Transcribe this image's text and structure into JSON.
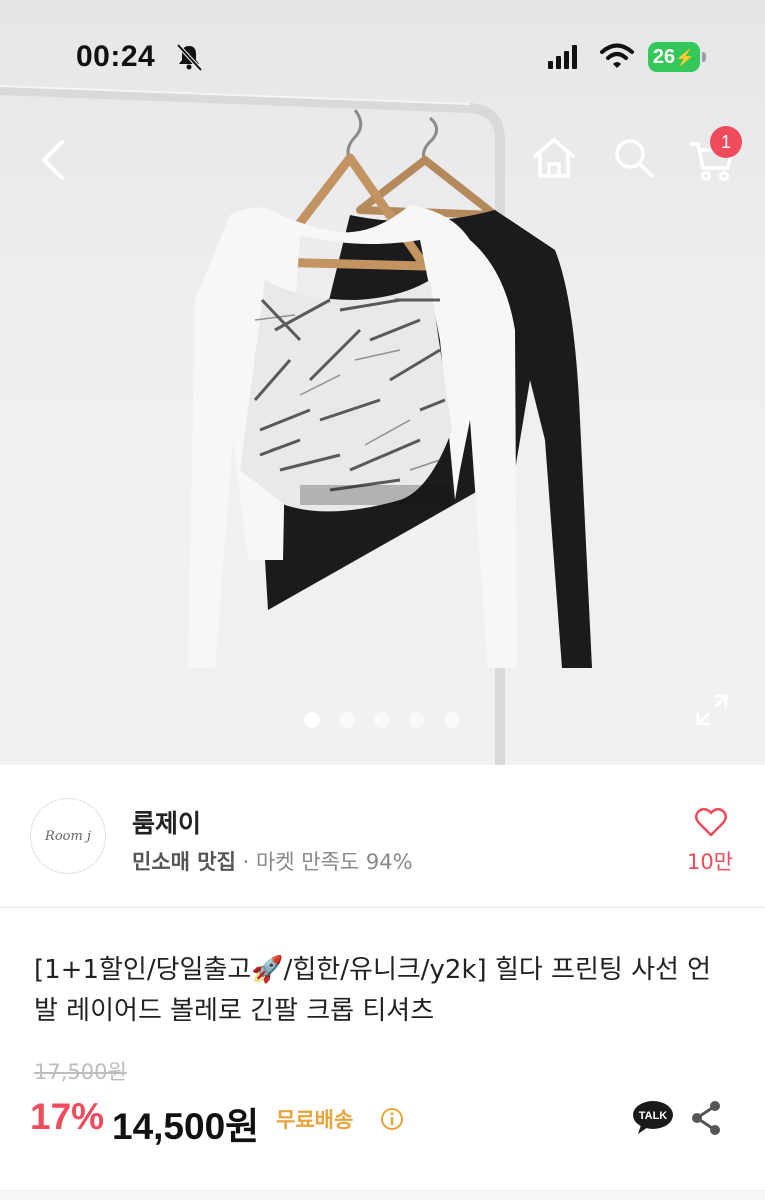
{
  "status_bar": {
    "time": "00:24",
    "battery": "26"
  },
  "nav": {
    "cart_count": "1"
  },
  "gallery": {
    "image_count": 5,
    "active_index": 0
  },
  "store": {
    "avatar_text": "Room j",
    "name": "룸제이",
    "tagline": "민소매 맛집",
    "satisfaction": " · 마켓 만족도 94%",
    "likes": "10만"
  },
  "product": {
    "title": "[1+1할인/당일출고🚀/힙한/유니크/y2k] 힐다 프린팅 사선 언발 레이어드 볼레로 긴팔 크롭 티셔츠",
    "original_price": "17,500원",
    "discount": "17%",
    "price": "14,500원",
    "shipping": "무료배송",
    "talk_label": "TALK"
  },
  "colors": {
    "accent": "#f04b5a",
    "shipping": "#e8a33a",
    "battery": "#34c759"
  }
}
